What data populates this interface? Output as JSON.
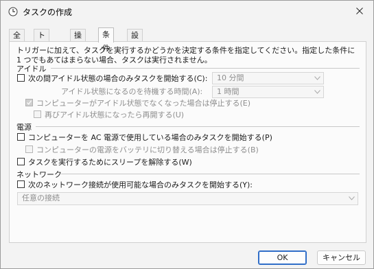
{
  "window": {
    "title": "タスクの作成",
    "close_icon": "close-icon"
  },
  "tabs": [
    {
      "label": "全般"
    },
    {
      "label": "トリガー"
    },
    {
      "label": "操作"
    },
    {
      "label": "条件",
      "active": true
    },
    {
      "label": "設定"
    }
  ],
  "conditions": {
    "intro": "トリガーに加えて、タスクを実行するかどうかを決定する条件を指定してください。指定した条件に 1 つでもあてはまらない場合、タスクは実行されません。",
    "idle": {
      "header": "アイドル",
      "start_if_idle": {
        "label": "次の間アイドル状態の場合のみタスクを開始する(C):",
        "checked": false
      },
      "idle_duration": {
        "value": "10 分間"
      },
      "wait_label": "アイドル状態になるのを待機する時間(A):",
      "wait_duration": {
        "value": "1 時間"
      },
      "stop_if_not_idle": {
        "label": "コンピューターがアイドル状態でなくなった場合は停止する(E)",
        "checked": true
      },
      "restart_if_idle": {
        "label": "再びアイドル状態になったら再開する(U)",
        "checked": false
      }
    },
    "power": {
      "header": "電源",
      "ac_only": {
        "label": "コンピューターを AC 電源で使用している場合のみタスクを開始する(P)",
        "checked": false
      },
      "stop_on_battery": {
        "label": "コンピューターの電源をバッテリに切り替える場合は停止する(B)",
        "checked": false
      },
      "wake": {
        "label": "タスクを実行するためにスリープを解除する(W)",
        "checked": false
      }
    },
    "network": {
      "header": "ネットワーク",
      "start_if_network": {
        "label": "次のネットワーク接続が使用可能な場合のみタスクを開始する(Y):",
        "checked": false
      },
      "connection": {
        "value": "任意の接続"
      }
    }
  },
  "footer": {
    "ok_label": "OK",
    "cancel_label": "キャンセル"
  },
  "colors": {
    "primary_border": "#2f6dc8",
    "background": "#f3f3f3"
  }
}
